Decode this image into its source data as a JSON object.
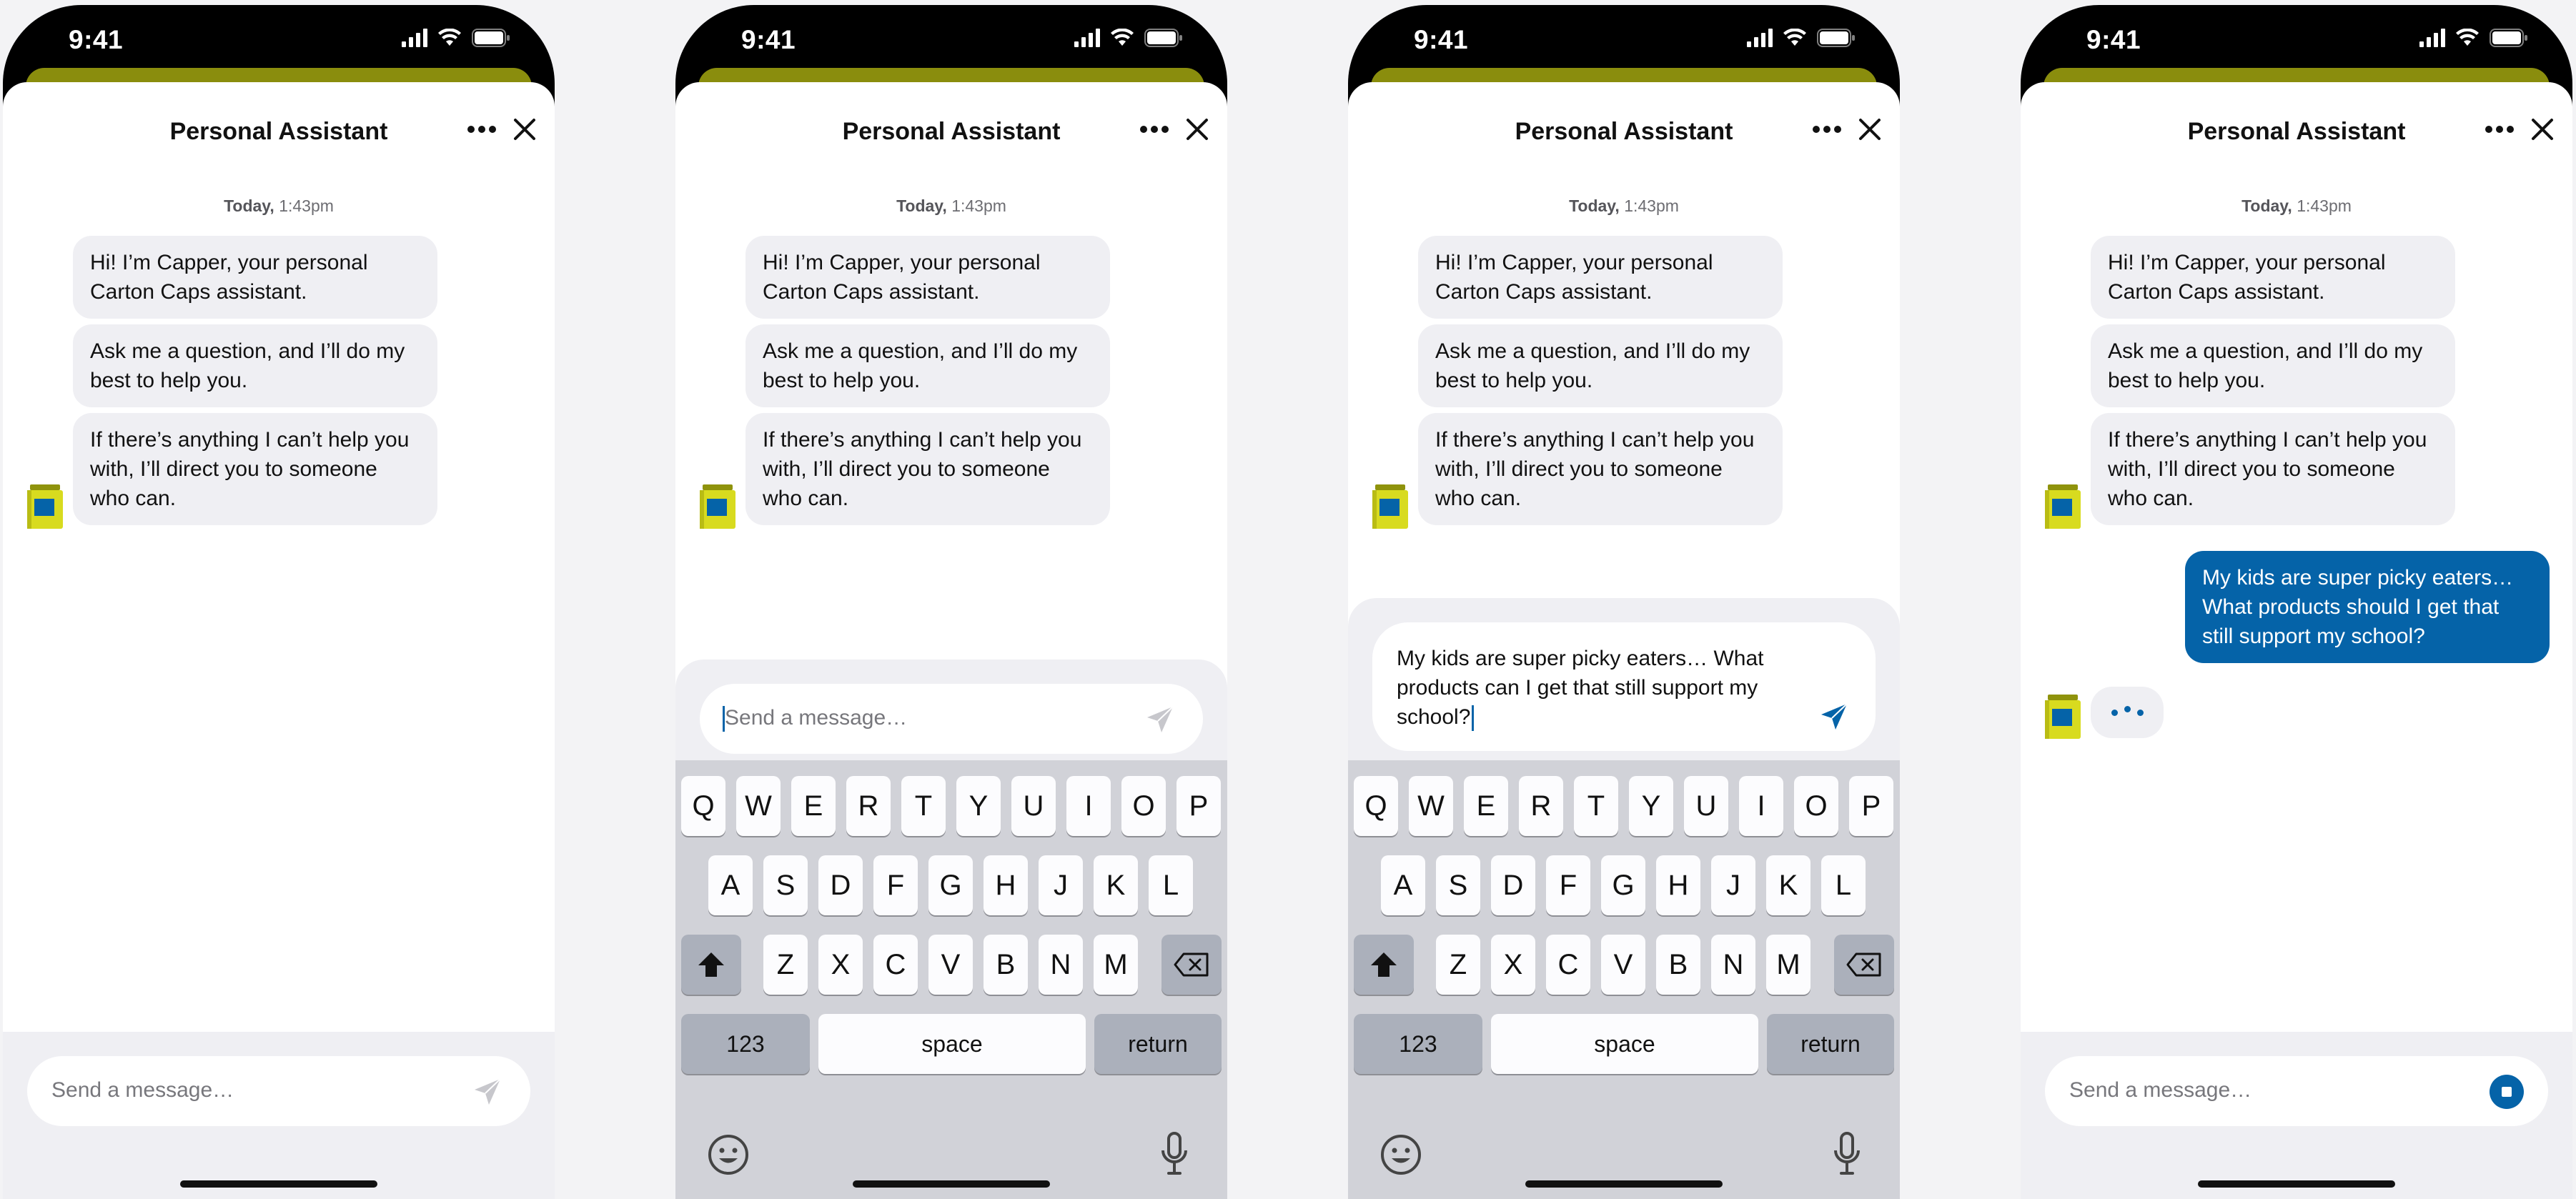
{
  "status": {
    "time": "9:41"
  },
  "header": {
    "title": "Personal Assistant"
  },
  "timestamp": {
    "day": "Today,",
    "time": "1:43pm"
  },
  "bot_messages": [
    "Hi! I’m Capper, your personal Carton Caps assistant.",
    "Ask me a question, and I’ll do my best to help you.",
    "If there’s anything I can’t help you with, I’ll direct you to someone who can."
  ],
  "user_message": "My kids are super picky eaters… What products should I get that still support my school?",
  "typed_message": "My kids are super picky eaters… What products can I get that still support my school?",
  "composer": {
    "placeholder": "Send a message…"
  },
  "keyboard": {
    "row1": [
      "Q",
      "W",
      "E",
      "R",
      "T",
      "Y",
      "U",
      "I",
      "O",
      "P"
    ],
    "row2": [
      "A",
      "S",
      "D",
      "F",
      "G",
      "H",
      "J",
      "K",
      "L"
    ],
    "row3": [
      "Z",
      "X",
      "C",
      "V",
      "B",
      "N",
      "M"
    ],
    "numbers": "123",
    "space": "space",
    "return": "return"
  },
  "colors": {
    "accent": "#0563a8",
    "brand_olive": "#8a8d0d",
    "bubble": "#efeff3"
  },
  "icons": {
    "more": "more-horizontal-icon",
    "close": "close-icon",
    "send": "send-icon",
    "stop": "stop-icon",
    "shift": "shift-icon",
    "backspace": "backspace-icon",
    "emoji": "emoji-icon",
    "mic": "microphone-icon",
    "avatar": "carton-caps-bin-icon"
  }
}
